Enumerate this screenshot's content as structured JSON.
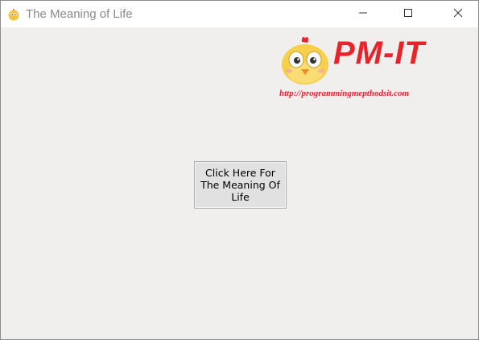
{
  "window": {
    "title": "The Meaning of Life",
    "icon": "chick-icon"
  },
  "caption_buttons": {
    "minimize": "minimize-icon",
    "maximize": "maximize-icon",
    "close": "close-icon"
  },
  "logo": {
    "text": "PM-IT",
    "url": "http://programmingmepthodsit.com",
    "mascot": "chick-mascot",
    "color": "#e8242a"
  },
  "main": {
    "button_label": "Click Here For The Meaning Of Life"
  }
}
